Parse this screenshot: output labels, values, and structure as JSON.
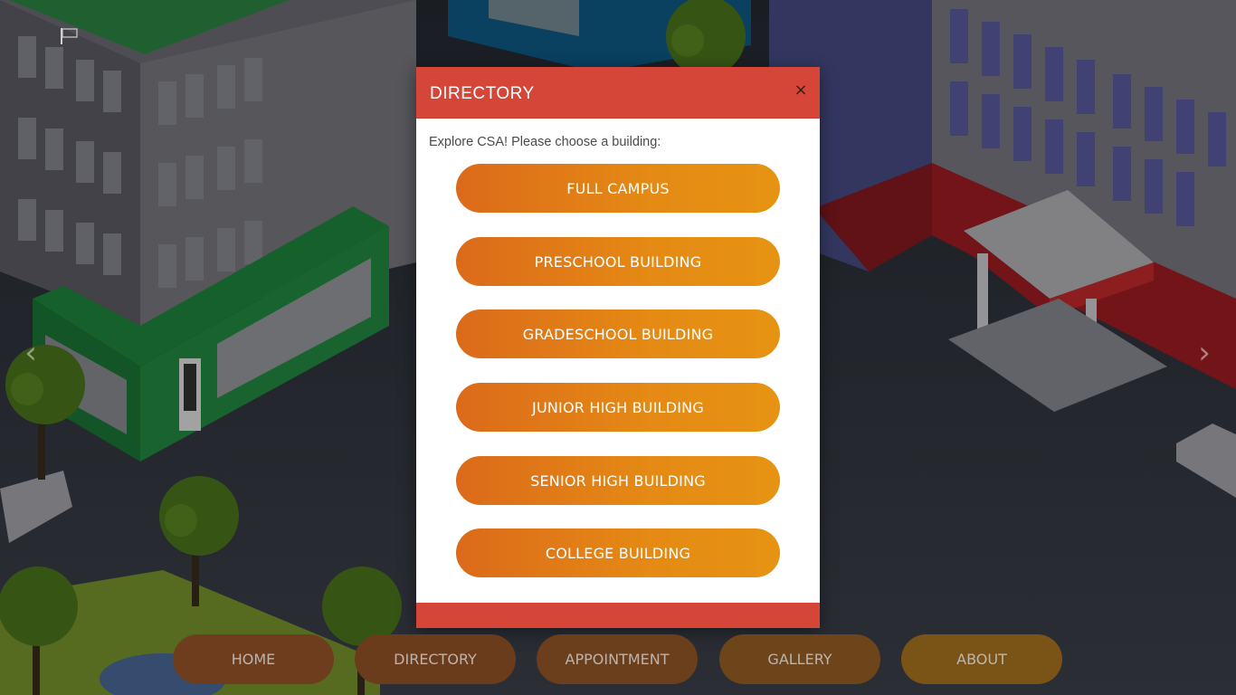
{
  "modal": {
    "title": "DIRECTORY",
    "close_label": "×",
    "intro": "Explore CSA! Please choose a building:",
    "buttons": [
      {
        "label": "FULL CAMPUS"
      },
      {
        "label": "PRESCHOOL BUILDING"
      },
      {
        "label": "GRADESCHOOL BUILDING"
      },
      {
        "label": "JUNIOR HIGH BUILDING"
      },
      {
        "label": "SENIOR HIGH BUILDING"
      },
      {
        "label": "COLLEGE BUILDING"
      }
    ]
  },
  "nav": [
    {
      "label": "HOME"
    },
    {
      "label": "DIRECTORY"
    },
    {
      "label": "APPOINTMENT"
    },
    {
      "label": "GALLERY"
    },
    {
      "label": "ABOUT"
    }
  ],
  "carousel": {
    "prev_icon": "chevron-left-icon",
    "next_icon": "chevron-right-icon",
    "prev_glyph": "‹",
    "next_glyph": "›"
  },
  "colors": {
    "modal_header": "#d54639",
    "button_gradient_start": "#db6a1a",
    "button_gradient_end": "#e69313"
  }
}
